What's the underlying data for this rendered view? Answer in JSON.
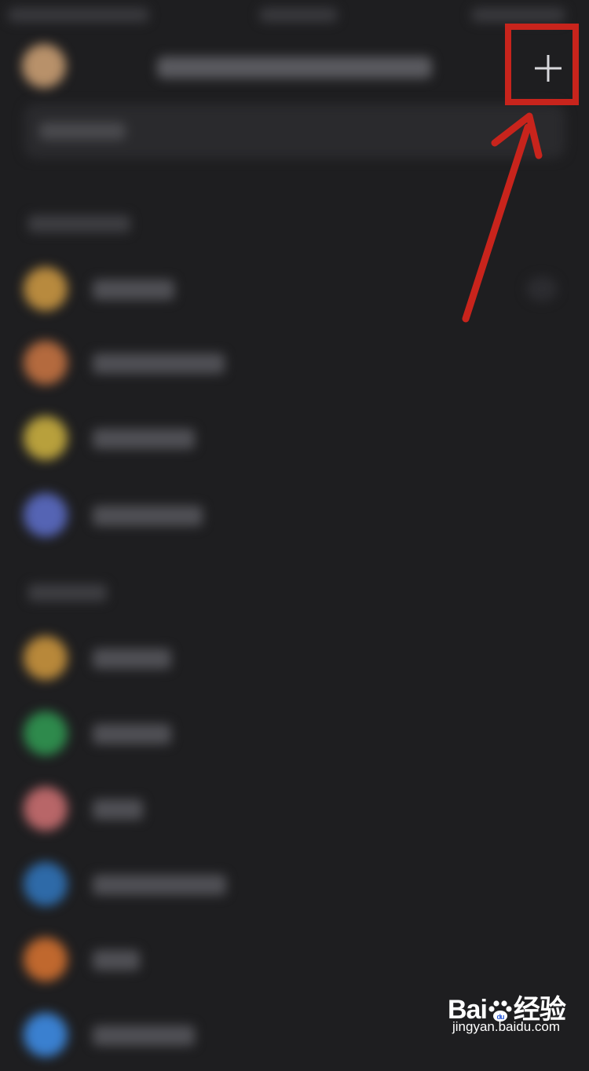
{
  "header": {
    "add_button": {
      "icon": "plus-icon",
      "label": "+"
    }
  },
  "list": {
    "sections": [
      {
        "items": [
          {
            "color": "#b88a3e"
          },
          {
            "color": "#b46a3e"
          },
          {
            "color": "#b8a03c"
          },
          {
            "color": "#5564b4"
          }
        ]
      },
      {
        "items": [
          {
            "color": "#b8883a"
          },
          {
            "color": "#2e8a4c"
          },
          {
            "color": "#b86668"
          },
          {
            "color": "#2e6aa8"
          },
          {
            "color": "#c0682e"
          },
          {
            "color": "#3a80d0"
          }
        ]
      }
    ]
  },
  "annotation": {
    "color": "#c8241c"
  },
  "watermark": {
    "brand_left": "Bai",
    "brand_right": "经验",
    "url": "jingyan.baidu.com"
  }
}
